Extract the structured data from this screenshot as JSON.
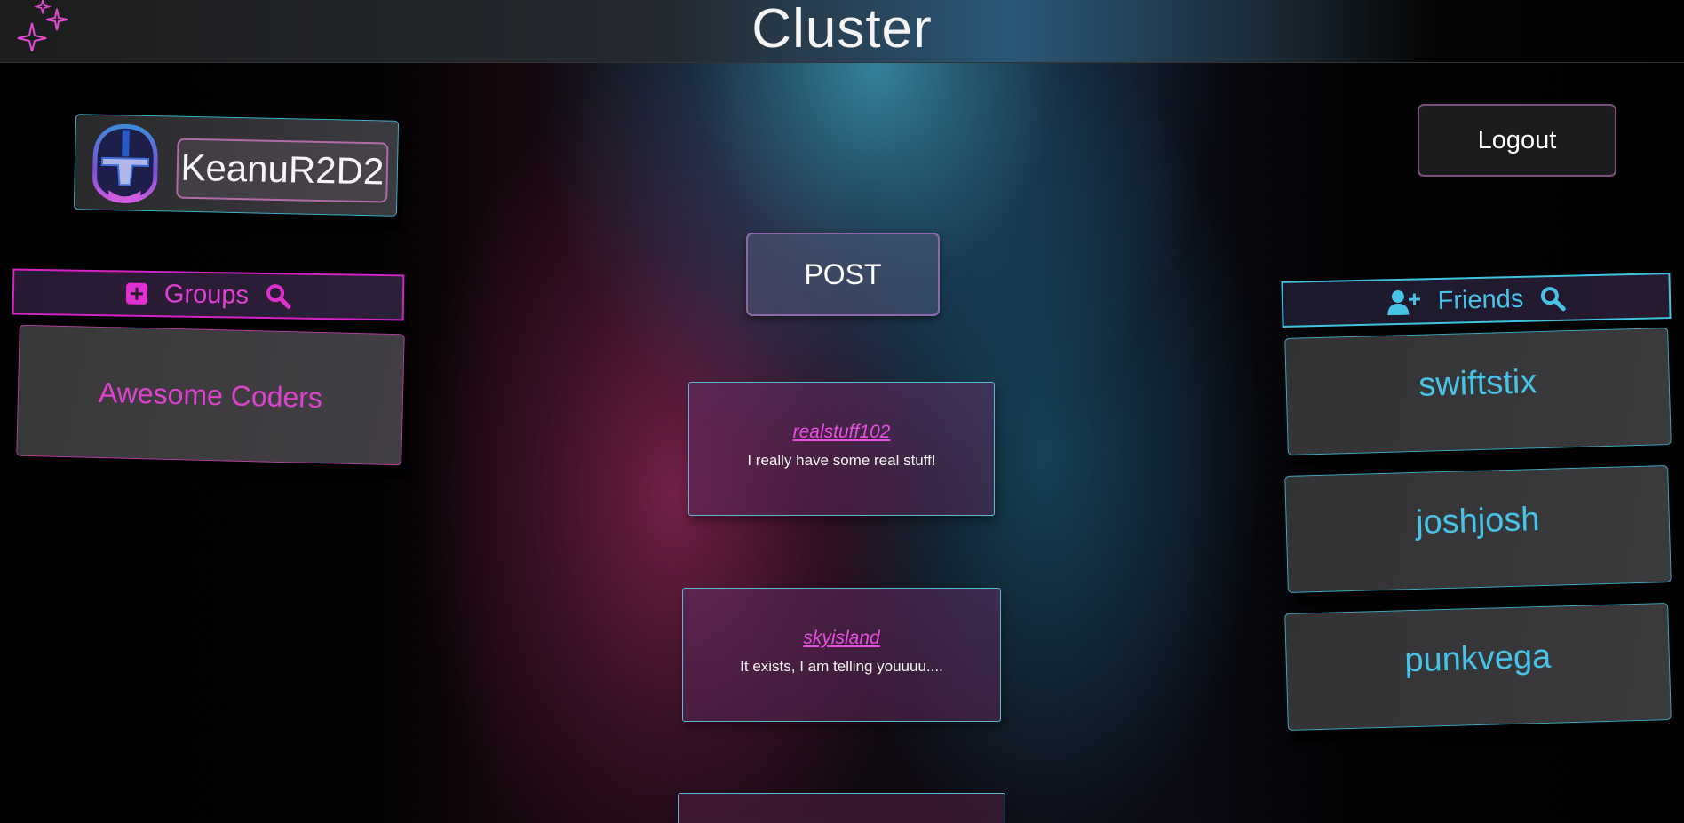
{
  "header": {
    "title": "Cluster",
    "logo_icon": "sparkles-icon"
  },
  "profile": {
    "username": "KeanuR2D2",
    "avatar_icon": "mandalorian-helmet-icon"
  },
  "actions": {
    "logout_label": "Logout",
    "post_label": "POST"
  },
  "groups": {
    "title": "Groups",
    "add_icon": "plus-square-icon",
    "search_icon": "search-icon",
    "items": [
      {
        "name": "Awesome Coders"
      }
    ]
  },
  "friends": {
    "title": "Friends",
    "add_icon": "user-plus-icon",
    "search_icon": "search-icon",
    "items": [
      {
        "name": "swiftstix"
      },
      {
        "name": "joshjosh"
      },
      {
        "name": "punkvega"
      }
    ]
  },
  "feed": {
    "posts": [
      {
        "author": "realstuff102",
        "text": "I really have some real stuff!"
      },
      {
        "author": "skyisland",
        "text": "It exists, I am telling youuuu...."
      }
    ]
  },
  "colors": {
    "accent_magenta": "#e040d6",
    "accent_cyan": "#48c3e8"
  }
}
